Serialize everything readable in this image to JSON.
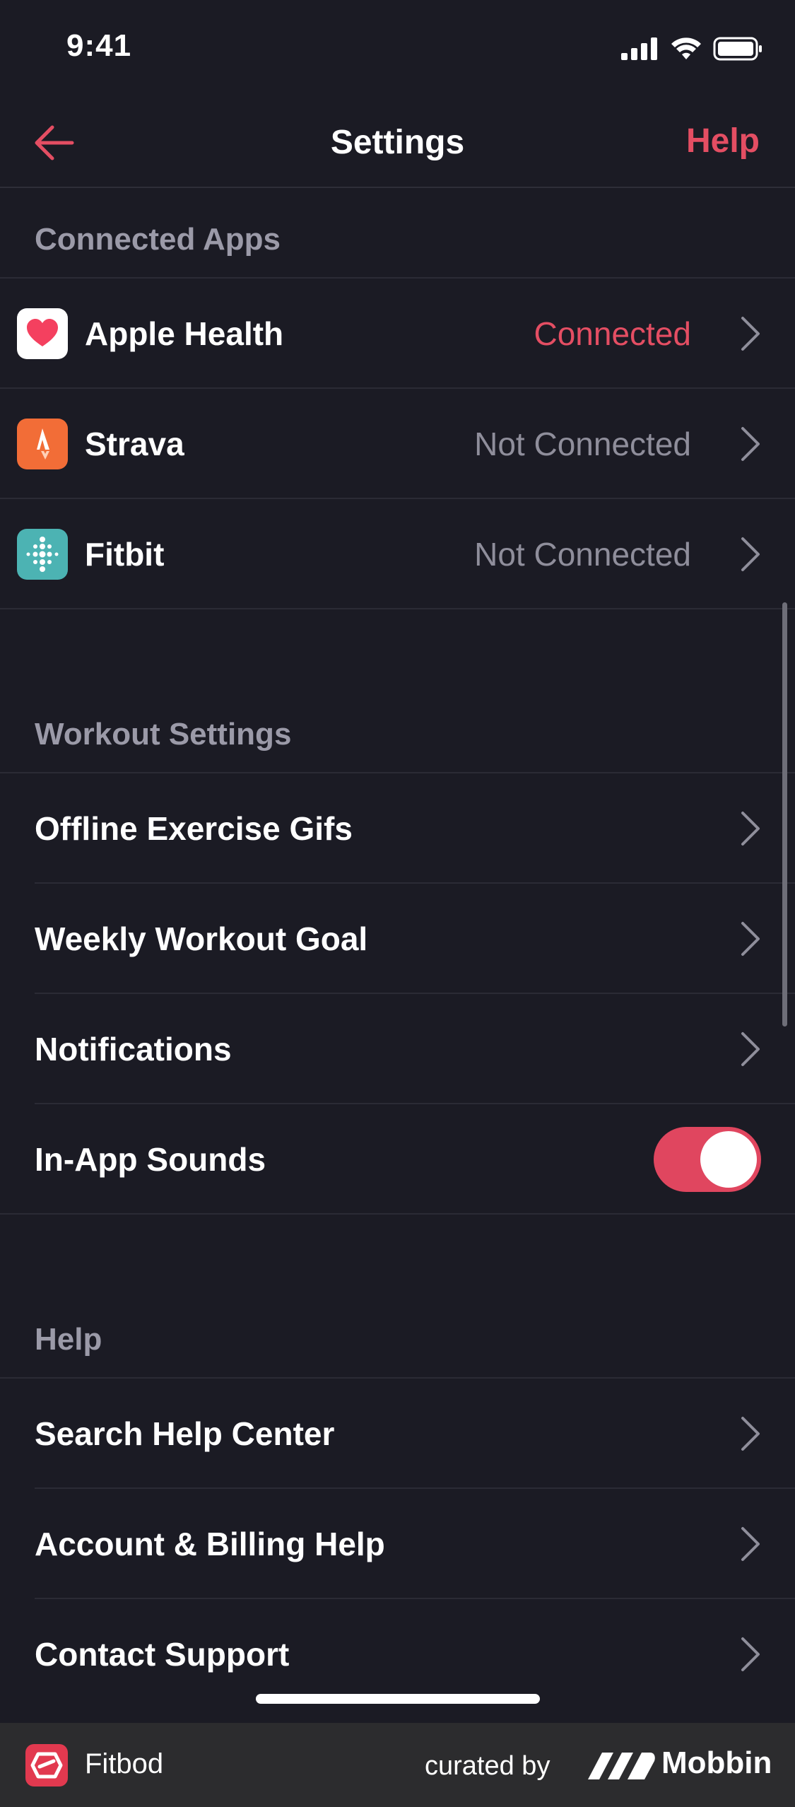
{
  "status_bar": {
    "time": "9:41"
  },
  "nav": {
    "title": "Settings",
    "help_label": "Help"
  },
  "sections": {
    "connected_apps": {
      "header": "Connected Apps",
      "items": [
        {
          "label": "Apple Health",
          "status": "Connected"
        },
        {
          "label": "Strava",
          "status": "Not Connected"
        },
        {
          "label": "Fitbit",
          "status": "Not Connected"
        }
      ]
    },
    "workout_settings": {
      "header": "Workout Settings",
      "items": [
        {
          "label": "Offline Exercise Gifs"
        },
        {
          "label": "Weekly Workout Goal"
        },
        {
          "label": "Notifications"
        },
        {
          "label": "In-App Sounds",
          "toggle_on": true
        }
      ]
    },
    "help": {
      "header": "Help",
      "items": [
        {
          "label": "Search Help Center"
        },
        {
          "label": "Account & Billing Help"
        },
        {
          "label": "Contact Support"
        }
      ]
    }
  },
  "footer": {
    "app_name": "Fitbod",
    "curated_by": "curated by",
    "brand": "Mobbin"
  },
  "colors": {
    "accent": "#e44e63",
    "background": "#1b1b24",
    "muted": "#8f8e9b"
  },
  "icons": [
    "back-arrow-icon",
    "chevron-right-icon",
    "apple-health-icon",
    "strava-icon",
    "fitbit-icon",
    "signal-icon",
    "wifi-icon",
    "battery-icon"
  ]
}
